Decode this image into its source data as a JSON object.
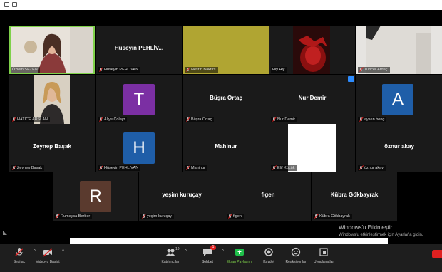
{
  "participants": {
    "p1": {
      "label": "Özlem SEZEN"
    },
    "p2": {
      "name": "Hüseyin PEHLİV...",
      "label": "Hüseyin PEHLİVAN"
    },
    "p3": {
      "label": "Nesrin Baktırs"
    },
    "p4": {
      "label": "Hly Hly"
    },
    "p5": {
      "label": "Tuncer Ardaç"
    },
    "p6": {
      "label": "HATİCE ARSLAN"
    },
    "p7": {
      "initial": "T",
      "label": "Aliye Çolayr"
    },
    "p8": {
      "name": "Büşra Ortaç",
      "label": "Büşra Ortaç"
    },
    "p9": {
      "name": "Nur Demir",
      "label": "Nur Demir"
    },
    "p10": {
      "initial": "A",
      "label": "aysen bong"
    },
    "p11": {
      "name": "Zeynep Başak",
      "label": "Zeynep Başak"
    },
    "p12": {
      "initial": "H",
      "label": "Hüseyin PEHLİVAN"
    },
    "p13": {
      "name": "Mahinur",
      "label": "Mahinur"
    },
    "p14": {
      "label": "Elif Küçük"
    },
    "p15": {
      "name": "öznur akay",
      "label": "öznur akay"
    },
    "p16": {
      "initial": "R",
      "label": "Rumeysa Berber"
    },
    "p17": {
      "name": "yeşim kuruçay",
      "label": "yeşim kuruçay"
    },
    "p18": {
      "name": "figen",
      "label": "figen"
    },
    "p19": {
      "name": "Kübra Gökbayrak",
      "label": "Kübra Gökbayrak"
    }
  },
  "colors": {
    "avatar_T": "#7b2fa3",
    "avatar_A": "#1f5ea8",
    "avatar_H": "#1f5ea8",
    "avatar_R": "#5a3a2e",
    "active_speaker": "#7fd14a"
  },
  "windows_watermark": {
    "title": "Windows'u Etkinleştir",
    "subtitle": "Windows'u etkinleştirmek için Ayarlar'a gidin."
  },
  "toolbar": {
    "mute_label": "Sesi aç",
    "video_label": "Videoyu Başlat",
    "participants_label": "Katılımcılar",
    "participants_count": "19",
    "chat_label": "Sohbet",
    "chat_badge": "1",
    "share_label": "Ekran Paylaşımı",
    "record_label": "Kaydet",
    "reactions_label": "Reaksiyonlar",
    "apps_label": "Uygulamalar"
  }
}
